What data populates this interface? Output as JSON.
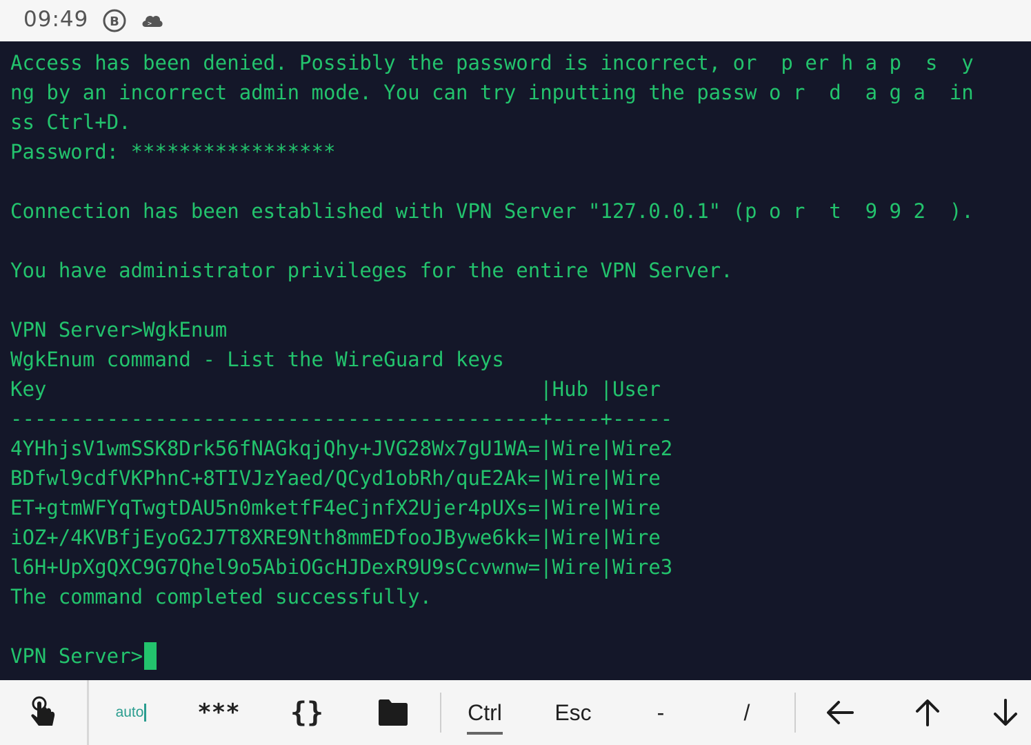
{
  "status_bar": {
    "time": "09:49",
    "icons": [
      "b-circle-icon",
      "cloud-terminal-icon"
    ]
  },
  "terminal": {
    "lines": [
      "Access has been denied. Possibly the password is incorrect, or  p er h a p  s  y",
      "ng by an incorrect admin mode. You can try inputting the passw o r  d  a g a  in",
      "ss Ctrl+D.",
      "Password: *****************",
      "",
      "Connection has been established with VPN Server \"127.0.0.1\" (p o r  t  9 9 2  ).",
      "",
      "You have administrator privileges for the entire VPN Server.",
      "",
      "VPN Server>WgkEnum",
      "WgkEnum command - List the WireGuard keys",
      "Key                                         |Hub |User",
      "--------------------------------------------+----+-----",
      "4YHhjsV1wmSSK8Drk56fNAGkqjQhy+JVG28Wx7gU1WA=|Wire|Wire2",
      "BDfwl9cdfVKPhnC+8TIVJzYaed/QCyd1obRh/quE2Ak=|Wire|Wire",
      "ET+gtmWFYqTwgtDAU5n0mketfF4eCjnfX2Ujer4pUXs=|Wire|Wire",
      "iOZ+/4KVBfjEyoG2J7T8XRE9Nth8mmEDfooJBywe6kk=|Wire|Wire",
      "l6H+UpXgQXC9G7Qhel9o5AbiOGcHJDexR9U9sCcvwnw=|Wire|Wire3",
      "The command completed successfully.",
      "",
      "VPN Server>"
    ]
  },
  "toolbar": {
    "touch_icon": "hand-pointer-icon",
    "auto_label": "auto",
    "password_label": "***",
    "braces_label": "{}",
    "folder_icon": "folder-icon",
    "ctrl_label": "Ctrl",
    "esc_label": "Esc",
    "dash_label": "-",
    "slash_label": "/",
    "left_icon": "arrow-left-icon",
    "up_icon": "arrow-up-icon",
    "down_icon": "arrow-down-icon"
  },
  "colors": {
    "terminal_bg": "#141729",
    "terminal_fg": "#23c36d",
    "toolbar_bg": "#f5f5f5",
    "accent": "#2a9d8f"
  }
}
